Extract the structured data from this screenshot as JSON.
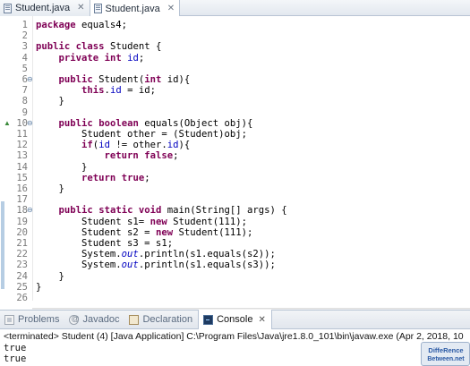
{
  "editor_tabs": [
    {
      "label": "Student.java",
      "active": false
    },
    {
      "label": "Student.java",
      "active": true
    }
  ],
  "code_lines": [
    {
      "num": "1",
      "tokens": [
        [
          "kw",
          "package"
        ],
        [
          "t",
          " equals4;"
        ]
      ]
    },
    {
      "num": "2",
      "tokens": []
    },
    {
      "num": "3",
      "tokens": [
        [
          "kw",
          "public"
        ],
        [
          "t",
          " "
        ],
        [
          "kw",
          "class"
        ],
        [
          "t",
          " Student {"
        ]
      ]
    },
    {
      "num": "4",
      "tokens": [
        [
          "t",
          "    "
        ],
        [
          "kw",
          "private"
        ],
        [
          "t",
          " "
        ],
        [
          "kw",
          "int"
        ],
        [
          "t",
          " "
        ],
        [
          "fld",
          "id"
        ],
        [
          "t",
          ";"
        ]
      ]
    },
    {
      "num": "5",
      "tokens": []
    },
    {
      "num": "6",
      "fold": true,
      "tokens": [
        [
          "t",
          "    "
        ],
        [
          "kw",
          "public"
        ],
        [
          "t",
          " Student("
        ],
        [
          "kw",
          "int"
        ],
        [
          "t",
          " id){"
        ]
      ]
    },
    {
      "num": "7",
      "tokens": [
        [
          "t",
          "        "
        ],
        [
          "kw",
          "this"
        ],
        [
          "t",
          "."
        ],
        [
          "fld",
          "id"
        ],
        [
          "t",
          " = id;"
        ]
      ]
    },
    {
      "num": "8",
      "tokens": [
        [
          "t",
          "    }"
        ]
      ]
    },
    {
      "num": "9",
      "tokens": []
    },
    {
      "num": "10",
      "fold": true,
      "override": true,
      "tokens": [
        [
          "t",
          "    "
        ],
        [
          "kw",
          "public"
        ],
        [
          "t",
          " "
        ],
        [
          "kw",
          "boolean"
        ],
        [
          "t",
          " equals(Object obj){"
        ]
      ]
    },
    {
      "num": "11",
      "tokens": [
        [
          "t",
          "        Student other = (Student)obj;"
        ]
      ]
    },
    {
      "num": "12",
      "tokens": [
        [
          "t",
          "        "
        ],
        [
          "kw",
          "if"
        ],
        [
          "t",
          "("
        ],
        [
          "fld",
          "id"
        ],
        [
          "t",
          " != other."
        ],
        [
          "fld",
          "id"
        ],
        [
          "t",
          "){"
        ]
      ]
    },
    {
      "num": "13",
      "tokens": [
        [
          "t",
          "            "
        ],
        [
          "kw",
          "return"
        ],
        [
          "t",
          " "
        ],
        [
          "kw",
          "false"
        ],
        [
          "t",
          ";"
        ]
      ]
    },
    {
      "num": "14",
      "tokens": [
        [
          "t",
          "        }"
        ]
      ]
    },
    {
      "num": "15",
      "tokens": [
        [
          "t",
          "        "
        ],
        [
          "kw",
          "return"
        ],
        [
          "t",
          " "
        ],
        [
          "kw",
          "true"
        ],
        [
          "t",
          ";"
        ]
      ]
    },
    {
      "num": "16",
      "tokens": [
        [
          "t",
          "    }"
        ]
      ]
    },
    {
      "num": "17",
      "tokens": []
    },
    {
      "num": "18",
      "fold": true,
      "tokens": [
        [
          "t",
          "    "
        ],
        [
          "kw",
          "public"
        ],
        [
          "t",
          " "
        ],
        [
          "kw",
          "static"
        ],
        [
          "t",
          " "
        ],
        [
          "kw",
          "void"
        ],
        [
          "t",
          " main(String[] args) {"
        ]
      ]
    },
    {
      "num": "19",
      "tokens": [
        [
          "t",
          "        Student s1= "
        ],
        [
          "kw",
          "new"
        ],
        [
          "t",
          " Student(111);"
        ]
      ]
    },
    {
      "num": "20",
      "tokens": [
        [
          "t",
          "        Student s2 = "
        ],
        [
          "kw",
          "new"
        ],
        [
          "t",
          " Student(111);"
        ]
      ]
    },
    {
      "num": "21",
      "tokens": [
        [
          "t",
          "        Student s3 = s1;"
        ]
      ]
    },
    {
      "num": "22",
      "tokens": [
        [
          "t",
          "        System."
        ],
        [
          "stat",
          "out"
        ],
        [
          "t",
          ".println(s1.equals(s2));"
        ]
      ]
    },
    {
      "num": "23",
      "tokens": [
        [
          "t",
          "        System."
        ],
        [
          "stat",
          "out"
        ],
        [
          "t",
          ".println(s1.equals(s3));"
        ]
      ]
    },
    {
      "num": "24",
      "tokens": [
        [
          "t",
          "    }"
        ]
      ]
    },
    {
      "num": "25",
      "tokens": [
        [
          "t",
          "}"
        ]
      ]
    },
    {
      "num": "26",
      "tokens": []
    }
  ],
  "panel_tabs": [
    {
      "label": "Problems",
      "icon": "problems-icon",
      "active": false
    },
    {
      "label": "Javadoc",
      "icon": "javadoc-icon",
      "active": false
    },
    {
      "label": "Declaration",
      "icon": "declaration-icon",
      "active": false
    },
    {
      "label": "Console",
      "icon": "console-icon",
      "active": true
    }
  ],
  "console": {
    "status": "<terminated> Student (4) [Java Application] C:\\Program Files\\Java\\jre1.8.0_101\\bin\\javaw.exe (Apr 2, 2018, 10",
    "output": [
      "true",
      "true"
    ]
  },
  "watermark_text": "DiffeRence Between.net",
  "colors": {
    "keyword": "#7f0055",
    "field": "#0000c0",
    "line_number": "#7a7a7a"
  }
}
